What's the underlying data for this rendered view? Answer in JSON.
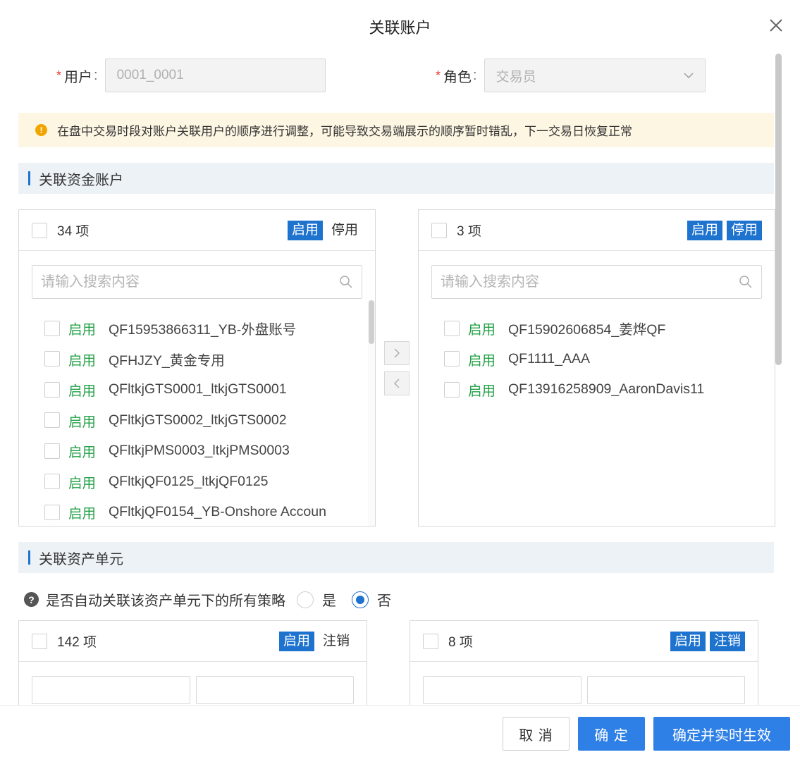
{
  "dialog": {
    "title": "关联账户"
  },
  "form": {
    "user_label": "用户",
    "user_value": "0001_0001",
    "role_label": "角色",
    "role_value": "交易员",
    "required_mark": "*",
    "colon": ":"
  },
  "notice": {
    "text": "在盘中交易时段对账户关联用户的顺序进行调整，可能导致交易端展示的顺序暂时错乱，下一交易日恢复正常",
    "icon": "warning-icon",
    "color": "#f0a500"
  },
  "fund_section": {
    "title": "关联资金账户",
    "left": {
      "count": "34 项",
      "btn_enable": "启用",
      "btn_disable": "停用",
      "search_placeholder": "请输入搜索内容",
      "items": [
        {
          "status": "启用",
          "name": "QF15953866311_YB-外盘账号"
        },
        {
          "status": "启用",
          "name": "QFHJZY_黄金专用"
        },
        {
          "status": "启用",
          "name": "QFltkjGTS0001_ltkjGTS0001"
        },
        {
          "status": "启用",
          "name": "QFltkjGTS0002_ltkjGTS0002"
        },
        {
          "status": "启用",
          "name": "QFltkjPMS0003_ltkjPMS0003"
        },
        {
          "status": "启用",
          "name": "QFltkjQF0125_ltkjQF0125"
        },
        {
          "status": "启用",
          "name": "QFltkjQF0154_YB-Onshore Accoun"
        }
      ]
    },
    "right": {
      "count": "3 项",
      "btn_enable": "启用",
      "btn_disable": "停用",
      "search_placeholder": "请输入搜索内容",
      "items": [
        {
          "status": "启用",
          "name": "QF15902606854_姜烨QF"
        },
        {
          "status": "启用",
          "name": "QF1111_AAA"
        },
        {
          "status": "启用",
          "name": "QF13916258909_AaronDavis11"
        }
      ]
    }
  },
  "asset_section": {
    "title": "关联资产单元",
    "question": "是否自动关联该资产单元下的所有策略",
    "option_yes": "是",
    "option_no": "否",
    "selected": "否",
    "left": {
      "count": "142 项",
      "btn_enable": "启用",
      "btn_disable": "注销"
    },
    "right": {
      "count": "8 项",
      "btn_enable": "启用",
      "btn_disable": "注销"
    }
  },
  "footer": {
    "cancel_label": "取 消",
    "ok_label": "确 定",
    "ok_live_label": "确定并实时生效"
  },
  "colors": {
    "accent": "#1e73cf",
    "primary_button": "#2f80e6",
    "status_green": "#24a148",
    "required": "#e53935"
  }
}
